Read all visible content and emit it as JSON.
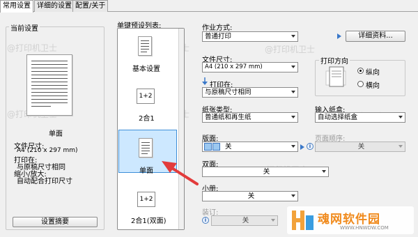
{
  "tabs": [
    "常用设置",
    "详细的设置",
    "配置/关于"
  ],
  "current": {
    "caption": "当前设置",
    "layout_label": "单面",
    "info_lines": [
      "文件尺寸:",
      "A4 (210 x 297 mm)",
      "打印在:",
      "与原稿尺寸相同",
      "缩小/放大:",
      "自动配合打印尺寸"
    ],
    "summary_button": "设置摘要"
  },
  "presets": {
    "caption": "单键预设列表:",
    "items": [
      {
        "label": "基本设置"
      },
      {
        "label": "2合1",
        "icon_text": "1+2"
      },
      {
        "label": "单面"
      },
      {
        "label": "2合1(双面)",
        "icon_text": "1+2"
      }
    ]
  },
  "settings": {
    "job_type_label": "作业方式:",
    "job_type_value": "普通打印",
    "details_button": "详细资料...",
    "paper_size_label": "文件尺寸:",
    "paper_size_value": "A4 (210 x 297 mm)",
    "print_on_label": "打印在:",
    "print_on_value": "与原稿尺寸相同",
    "orientation_caption": "打印方向",
    "orientation_options": [
      "纵向",
      "横向"
    ],
    "paper_type_label": "纸张类型:",
    "paper_type_value": "普通纸和再生纸",
    "input_tray_label": "输入纸盒:",
    "input_tray_value": "自动选择纸盒",
    "layout_label": "版面:",
    "layout_value": "关",
    "page_order_label": "页面顺序:",
    "page_order_value": "关",
    "duplex_label": "双面:",
    "duplex_value": "关",
    "booklet_label": "小册:",
    "booklet_value": "关",
    "staple_label": "装订:",
    "staple_value": "关"
  },
  "watermarks": [
    "@打印机卫士"
  ],
  "badge": {
    "title": "魂网软件园",
    "url": "WWW.HNWDW.COM"
  },
  "colors": {
    "selected_bg": "#cde8ff",
    "selected_border": "#3d8fd8",
    "arrow": "#e23b3b",
    "accent": "#3a78c9"
  }
}
